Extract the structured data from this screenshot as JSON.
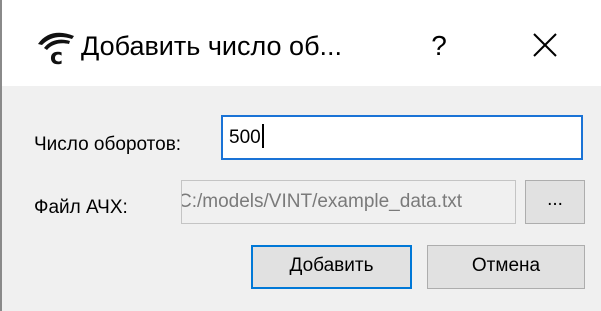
{
  "dialog": {
    "title": "Добавить число об...",
    "help_label": "?",
    "close_icon": "close-icon",
    "app_icon": "app-logo-icon"
  },
  "form": {
    "turns_label": "Число оборотов:",
    "turns_value": "500",
    "file_label": "Файл АЧХ:",
    "file_value": "C:/models/VINT/example_data.txt",
    "browse_label": "..."
  },
  "buttons": {
    "add_label": "Добавить",
    "cancel_label": "Отмена"
  },
  "colors": {
    "focus_border": "#1a73d6",
    "default_button_border": "#0078d7",
    "dialog_bg": "#f0f0f0"
  }
}
